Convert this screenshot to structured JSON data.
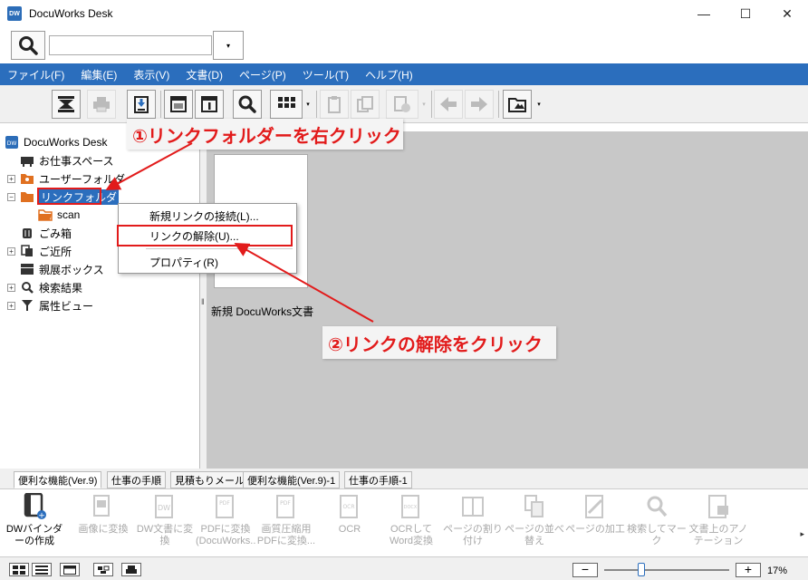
{
  "window": {
    "app_icon_text": "DW",
    "title": "DocuWorks Desk",
    "minimize": "—",
    "maximize": "☐",
    "close": "✕"
  },
  "search": {
    "value": "",
    "placeholder": "",
    "dropdown_glyph": "▾"
  },
  "menubar": {
    "items": [
      "ファイル(F)",
      "編集(E)",
      "表示(V)",
      "文書(D)",
      "ページ(P)",
      "ツール(T)",
      "ヘルプ(H)"
    ]
  },
  "tree": {
    "items": [
      {
        "label": "DocuWorks Desk",
        "icon": "dw-desk-icon",
        "expander": ""
      },
      {
        "label": "お仕事スペース",
        "icon": "workspace-icon",
        "expander": ""
      },
      {
        "label": "ユーザーフォルダ",
        "icon": "user-folder-icon",
        "expander": "+"
      },
      {
        "label": "リンクフォルダ",
        "icon": "link-folder-icon",
        "expander": "−"
      },
      {
        "label": "scan",
        "icon": "folder-icon",
        "expander": ""
      },
      {
        "label": "ごみ箱",
        "icon": "trash-icon",
        "expander": ""
      },
      {
        "label": "ご近所",
        "icon": "neighbor-icon",
        "expander": "+"
      },
      {
        "label": "親展ボックス",
        "icon": "confidential-box-icon",
        "expander": ""
      },
      {
        "label": "検索結果",
        "icon": "search-icon",
        "expander": "+"
      },
      {
        "label": "属性ビュー",
        "icon": "filter-icon",
        "expander": "+"
      }
    ]
  },
  "document": {
    "name": "新規 DocuWorks文書"
  },
  "context_menu": {
    "items": [
      "新規リンクの接続(L)...",
      "リンクの解除(U)...",
      "プロパティ(R)"
    ]
  },
  "annotations": {
    "step1": "①リンクフォルダーを右クリック",
    "step2": "②リンクの解除をクリック",
    "color": "#e21b1b"
  },
  "tabs": [
    "便利な機能(Ver.9)",
    "仕事の手順",
    "見積もりメール",
    "便利な機能(Ver.9)-1",
    "仕事の手順-1"
  ],
  "functions": [
    {
      "label": "DWバインダーの作成",
      "enabled": true
    },
    {
      "label": "画像に変換",
      "enabled": false
    },
    {
      "label": "DW文書に変換",
      "enabled": false
    },
    {
      "label": "PDFに変換(DocuWorks...",
      "enabled": false
    },
    {
      "label": "画質圧縮用PDFに変換...",
      "enabled": false
    },
    {
      "label": "OCR",
      "enabled": false
    },
    {
      "label": "OCRしてWord変換",
      "enabled": false
    },
    {
      "label": "ページの割り付け",
      "enabled": false
    },
    {
      "label": "ページの並べ替え",
      "enabled": false
    },
    {
      "label": "ページの加工",
      "enabled": false
    },
    {
      "label": "検索してマーク",
      "enabled": false
    },
    {
      "label": "文書上のアノテーションを...",
      "enabled": false
    }
  ],
  "status": {
    "zoom_minus": "−",
    "zoom_plus": "+",
    "zoom": "17%"
  },
  "colors": {
    "accent": "#2b6ebd",
    "annotation": "#e21b1b",
    "folder": "#e07020"
  }
}
